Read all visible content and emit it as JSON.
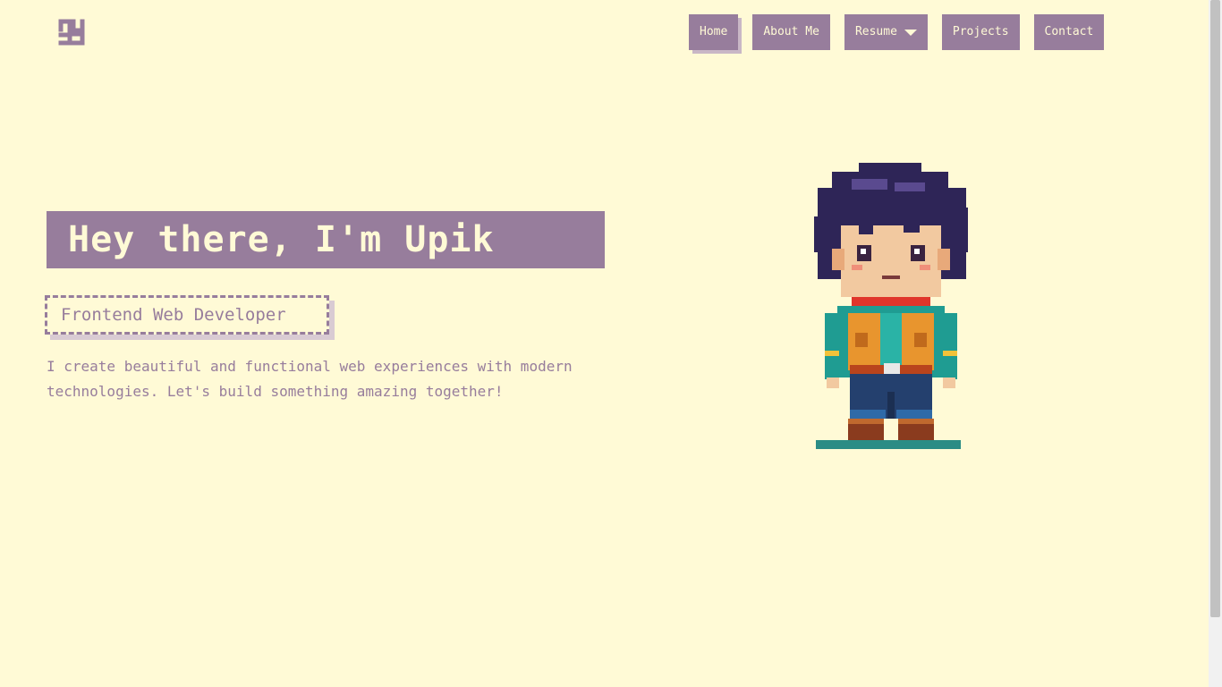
{
  "nav": {
    "items": [
      {
        "label": "Home",
        "active": true
      },
      {
        "label": "About Me",
        "active": false
      },
      {
        "label": "Resume",
        "active": false,
        "has_dropdown": true
      },
      {
        "label": "Projects",
        "active": false
      },
      {
        "label": "Contact",
        "active": false
      }
    ]
  },
  "hero": {
    "title": "Hey there, I'm Upik",
    "role": "Frontend Web Developer",
    "intro": "I create beautiful and functional web experiences with modern technologies. Let's build something amazing together!"
  },
  "icons": {
    "logo": "knot-logo-icon",
    "resume_caret": "chevron-down-icon",
    "hero_image": "pixel-character-avatar"
  },
  "colors": {
    "background": "#fffad6",
    "accent": "#977d9c",
    "shadow": "#c9b7c6",
    "text_light": "#fffad6"
  }
}
